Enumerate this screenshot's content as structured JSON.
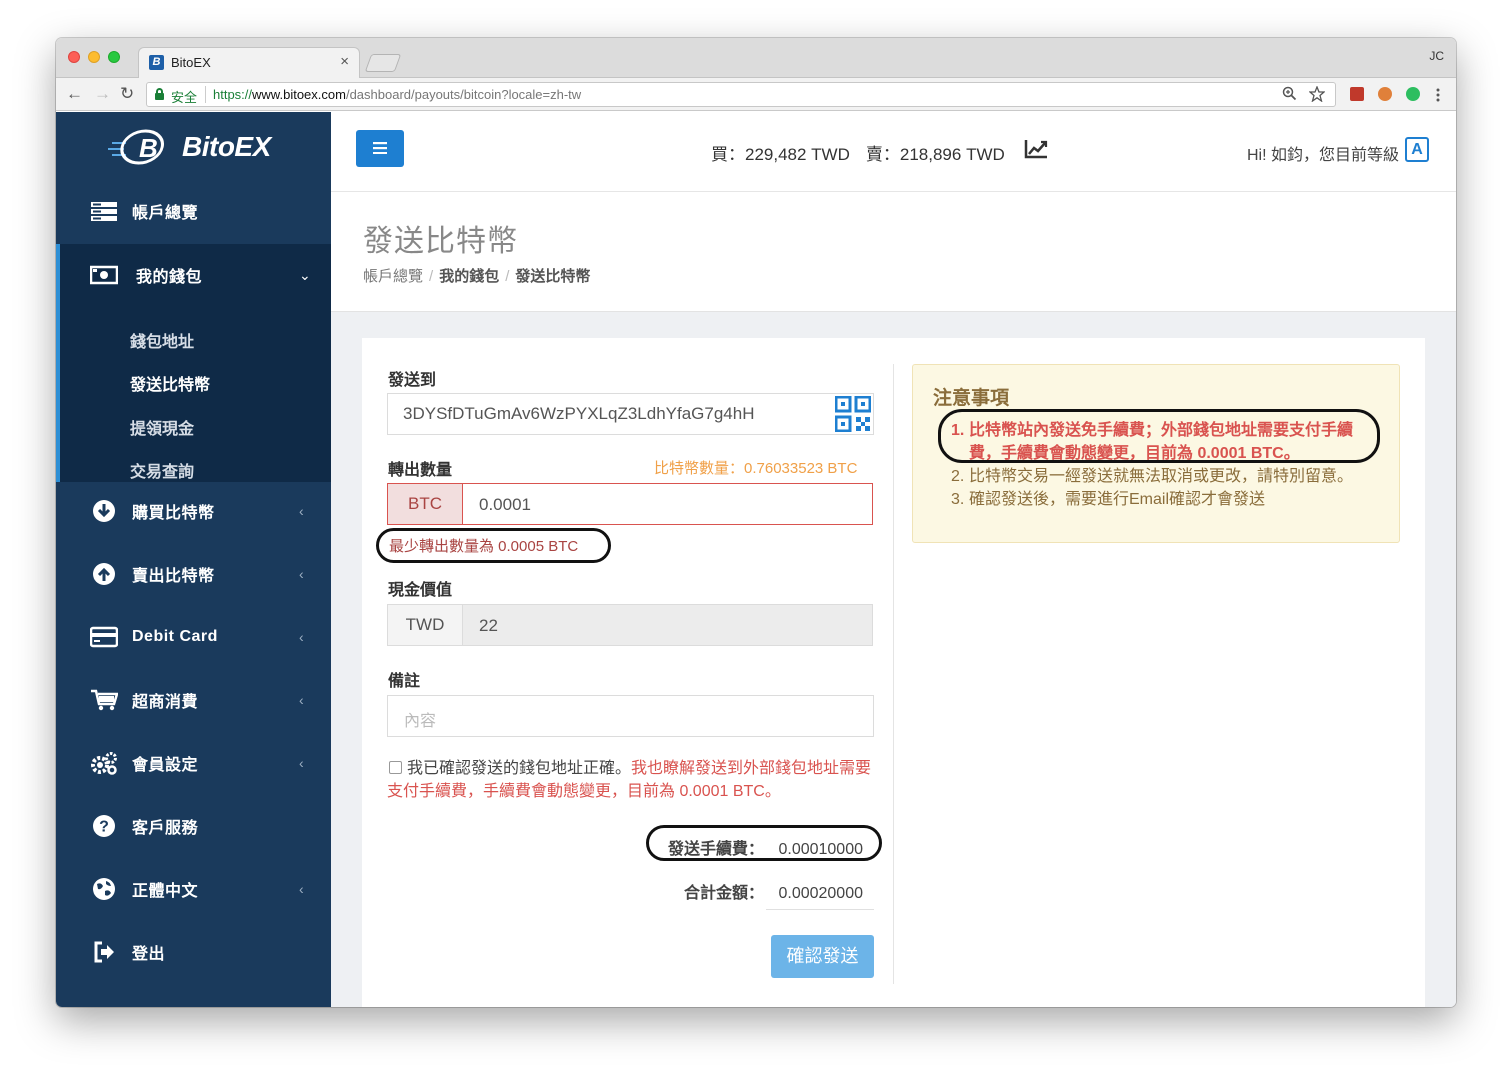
{
  "browser": {
    "tab_title": "BitoEX",
    "tab_favicon": "B",
    "tab_close": "×",
    "profile_initials": "JC",
    "secure_label": "安全",
    "url_scheme": "https://",
    "url_host": "www.bitoex.com",
    "url_path": "/dashboard/payouts/bitcoin?locale=zh-tw",
    "nav_back": "←",
    "nav_forward": "→",
    "nav_reload": "↻"
  },
  "sidebar": {
    "logo_text": "BitoEX",
    "items": [
      {
        "label": "帳戶總覽",
        "icon": "dashboard-icon"
      },
      {
        "label": "我的錢包",
        "icon": "wallet-icon"
      },
      {
        "label": "購買比特幣",
        "icon": "download-circle-icon"
      },
      {
        "label": "賣出比特幣",
        "icon": "upload-circle-icon"
      },
      {
        "label": "Debit Card",
        "icon": "credit-card-icon"
      },
      {
        "label": "超商消費",
        "icon": "shopping-cart-icon"
      },
      {
        "label": "會員設定",
        "icon": "gears-icon"
      },
      {
        "label": "客戶服務",
        "icon": "question-circle-icon"
      },
      {
        "label": "正體中文",
        "icon": "globe-icon"
      },
      {
        "label": "登出",
        "icon": "sign-out-icon"
      }
    ],
    "wallet_sub": [
      "錢包地址",
      "發送比特幣",
      "提領現金",
      "交易查詢"
    ],
    "active_sub": "發送比特幣"
  },
  "header": {
    "buy_rate": "買：229,482 TWD",
    "sell_rate": "賣：218,896 TWD",
    "greeting": "Hi! 如鈞，您目前等級",
    "level": "A"
  },
  "page": {
    "title": "發送比特幣",
    "breadcrumbs": [
      "帳戶總覽",
      "我的錢包",
      "發送比特幣"
    ]
  },
  "form": {
    "send_to_label": "發送到",
    "address": "3DYSfDTuGmAv6WzPYXLqZ3LdhYfaG7g4hH",
    "amount_label": "轉出數量",
    "available": "比特幣數量：0.76033523 BTC",
    "amount_unit": "BTC",
    "amount_value": "0.0001",
    "amount_error": "最少轉出數量為 0.0005 BTC",
    "cash_label": "現金價值",
    "cash_unit": "TWD",
    "cash_value": "22",
    "note_label": "備註",
    "note_placeholder": "內容",
    "confirm_text": "我已確認發送的錢包地址正確。",
    "confirm_text_red": "我也瞭解發送到外部錢包地址需要支付手續費，手續費會動態變更，目前為 0.0001 BTC。",
    "fee_label": "發送手續費：",
    "fee_value": "0.00010000",
    "total_label": "合計金額：",
    "total_value": "0.00020000",
    "submit_label": "確認發送"
  },
  "notice": {
    "title": "注意事項",
    "items": [
      {
        "num": "1.",
        "text": "比特幣站內發送免手續費；外部錢包地址需要支付手續費，手續費會動態變更，目前為 0.0001 BTC。"
      },
      {
        "num": "2.",
        "text": "比特幣交易一經發送就無法取消或更改，請特別留意。"
      },
      {
        "num": "3.",
        "text": "確認發送後，需要進行Email確認才會發送"
      }
    ]
  },
  "colors": {
    "sidebar_bg": "#1a3a5c",
    "sidebar_active_bg": "#0f2a47",
    "accent": "#1e7fd1",
    "error": "#d9534f",
    "warning_text": "#8a6d3b",
    "available_text": "#f0a048"
  }
}
